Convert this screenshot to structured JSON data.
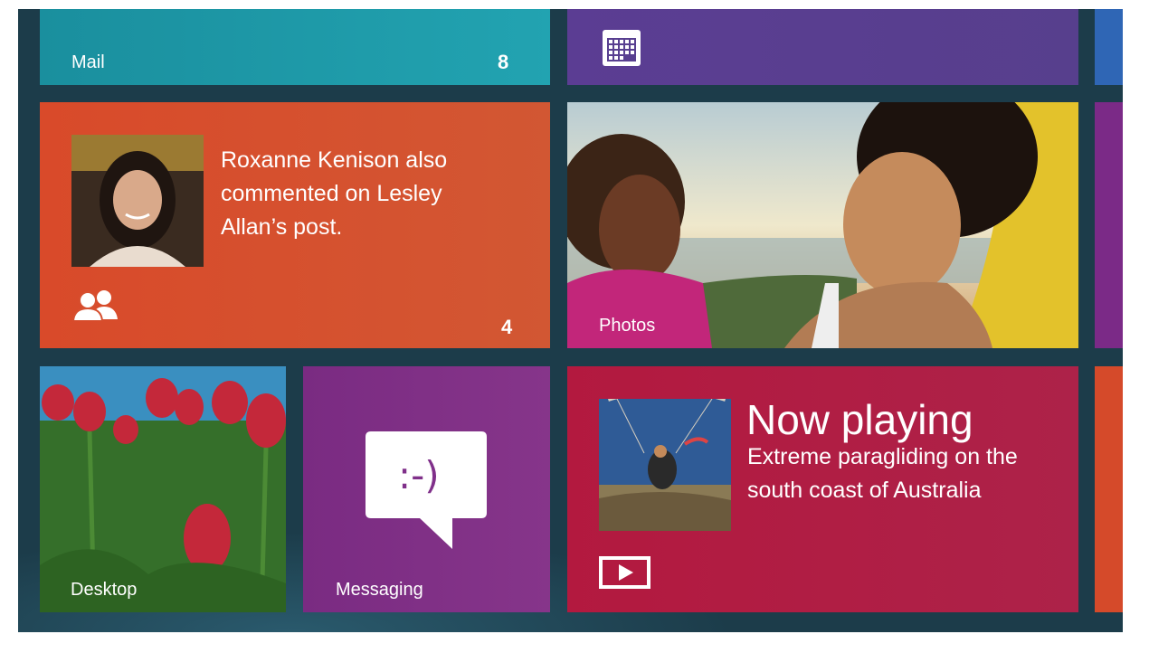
{
  "tiles": {
    "mail": {
      "label": "Mail",
      "count": "8",
      "color": "#1f9aa8"
    },
    "calendar": {
      "icon": "calendar-icon",
      "color": "#583f90"
    },
    "people": {
      "notification": "Roxanne Kenison also commented on Lesley Allan’s post.",
      "count": "4",
      "icon": "people-icon",
      "color": "#d65030"
    },
    "photos": {
      "label": "Photos"
    },
    "desktop": {
      "label": "Desktop"
    },
    "messaging": {
      "label": "Messaging",
      "emoticon": ":-)",
      "icon": "speech-bubble-icon",
      "color": "#80308a"
    },
    "video": {
      "title": "Now playing",
      "description": "Extreme paragliding on the south coast of Australia",
      "icon": "play-icon",
      "color": "#b01d44"
    }
  }
}
